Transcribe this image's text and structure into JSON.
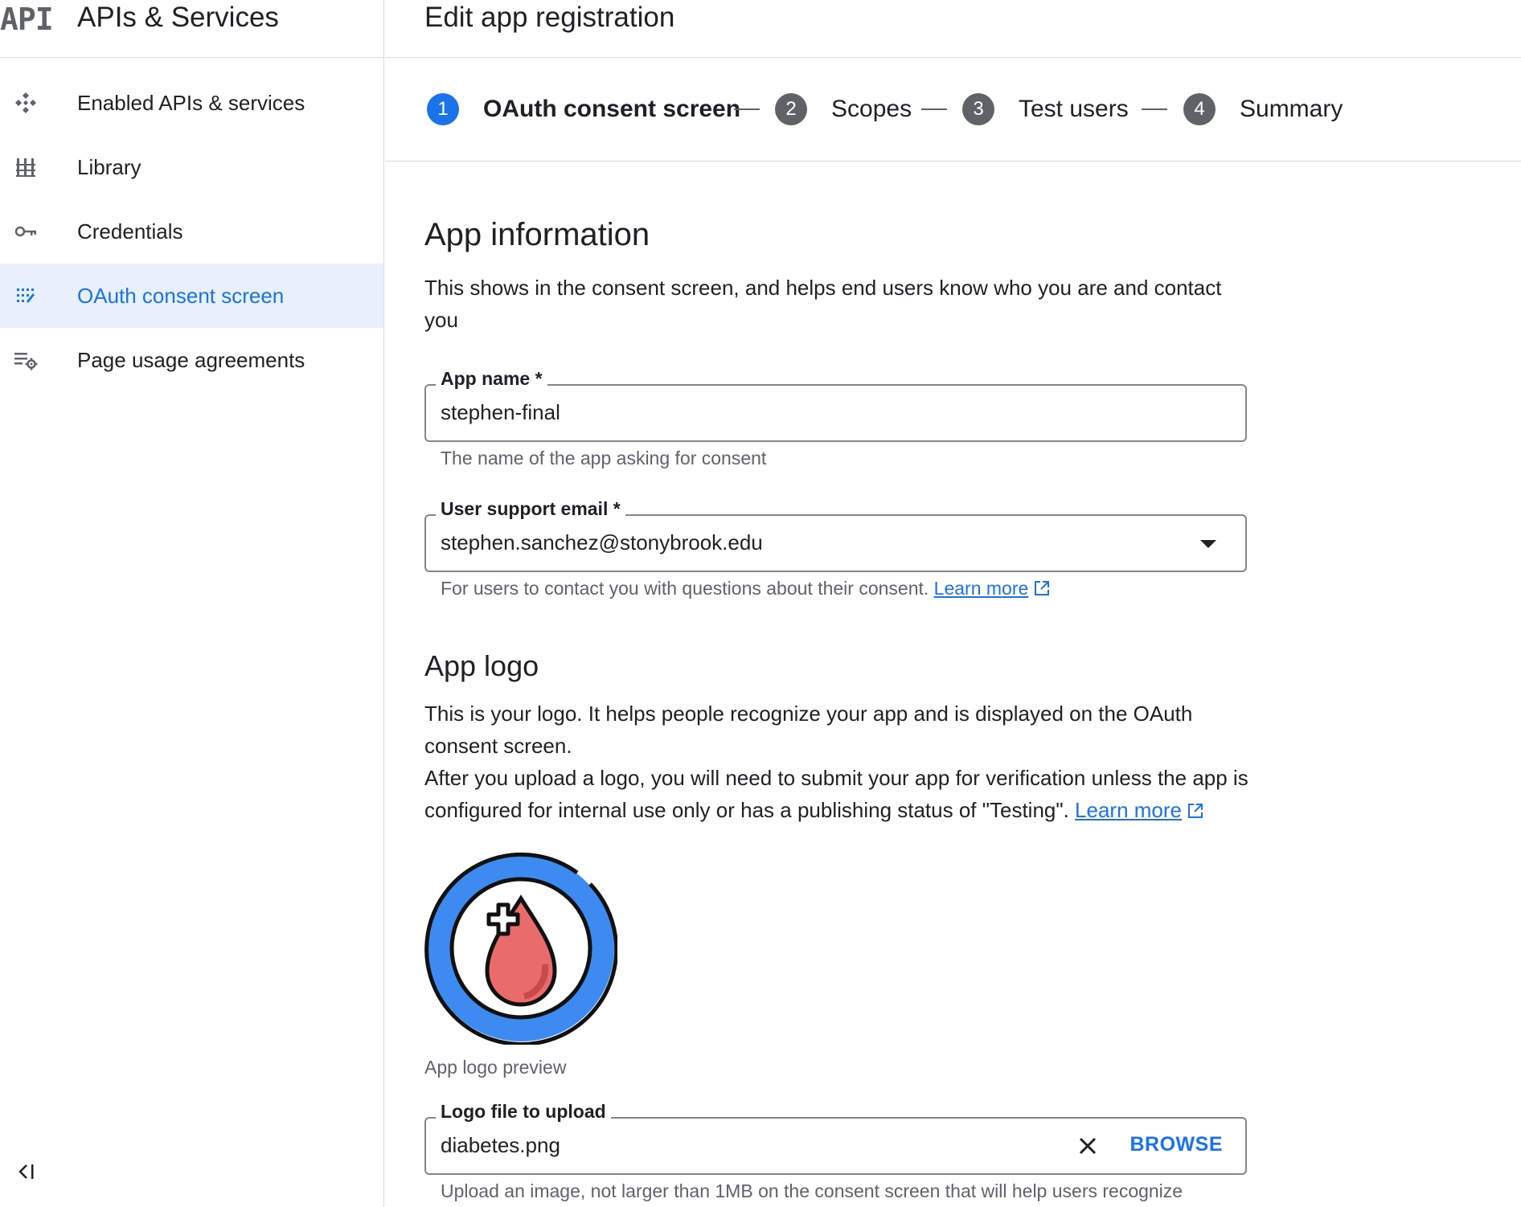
{
  "sidebar": {
    "logo_text": "API",
    "product_name": "APIs & Services",
    "items": [
      {
        "label": "Enabled APIs & services",
        "icon": "enabled-apis-icon"
      },
      {
        "label": "Library",
        "icon": "library-icon"
      },
      {
        "label": "Credentials",
        "icon": "key-icon"
      },
      {
        "label": "OAuth consent screen",
        "icon": "oauth-consent-icon",
        "active": true
      },
      {
        "label": "Page usage agreements",
        "icon": "settings-list-icon"
      }
    ],
    "collapse_label": "<|"
  },
  "header": {
    "title": "Edit app registration"
  },
  "stepper": {
    "steps": [
      {
        "number": "1",
        "label": "OAuth consent screen",
        "active": true
      },
      {
        "number": "2",
        "label": "Scopes"
      },
      {
        "number": "3",
        "label": "Test users"
      },
      {
        "number": "4",
        "label": "Summary"
      }
    ]
  },
  "app_info": {
    "heading": "App information",
    "description": "This shows in the consent screen, and helps end users know who you are and contact you",
    "app_name": {
      "label": "App name *",
      "value": "stephen-final",
      "hint": "The name of the app asking for consent"
    },
    "support_email": {
      "label": "User support email *",
      "value": "stephen.sanchez@stonybrook.edu",
      "hint": "For users to contact you with questions about their consent.",
      "link": "Learn more"
    }
  },
  "app_logo": {
    "heading": "App logo",
    "description_1": "This is your logo. It helps people recognize your app and is displayed on the OAuth consent screen.",
    "description_2": "After you upload a logo, you will need to submit your app for verification unless the app is configured for internal use only or has a publishing status of \"Testing\".",
    "link": "Learn more",
    "preview_caption": "App logo preview",
    "file_field": {
      "label": "Logo file to upload",
      "value": "diabetes.png",
      "browse_label": "BROWSE",
      "hint": "Upload an image, not larger than 1MB on the consent screen that will help users recognize"
    }
  },
  "colors": {
    "accent": "#1a73e8",
    "active_nav_bg": "#e8f0fe",
    "logo_ring": "#3d8bf0",
    "logo_drop": "#ea6b6b"
  }
}
